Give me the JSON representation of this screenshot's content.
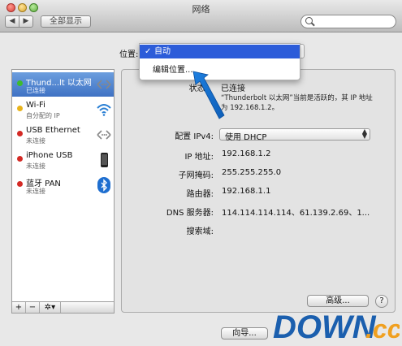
{
  "window": {
    "title": "网络"
  },
  "toolbar": {
    "back_label": "◀",
    "forward_label": "▶",
    "show_all_label": "全部显示",
    "search_placeholder": ""
  },
  "location": {
    "label": "位置:",
    "options": [
      {
        "label": "自动",
        "checked": true
      },
      {
        "label": "编辑位置..."
      }
    ],
    "check": "✓"
  },
  "services": [
    {
      "name": "Thund...lt 以太网",
      "status": "已连接",
      "dot": "green",
      "icon": "ethernet-icon"
    },
    {
      "name": "Wi-Fi",
      "status": "自分配的 IP",
      "dot": "yellow",
      "icon": "wifi-icon"
    },
    {
      "name": "USB Ethernet",
      "status": "未连接",
      "dot": "red",
      "icon": "ethernet-icon"
    },
    {
      "name": "iPhone USB",
      "status": "未连接",
      "dot": "red",
      "icon": "iphone-icon"
    },
    {
      "name": "蓝牙 PAN",
      "status": "未连接",
      "dot": "red",
      "icon": "bluetooth-icon"
    }
  ],
  "sidebar_buttons": {
    "add": "+",
    "remove": "−",
    "gear": "✲▾"
  },
  "detail": {
    "status_label": "状态:",
    "status_value": "已连接",
    "status_desc_1": "“Thunderbolt 以太网”当前是活跃的，其 IP 地址",
    "status_desc_2": "为 192.168.1.2。",
    "configure_label": "配置 IPv4:",
    "configure_value": "使用 DHCP",
    "ip_label": "IP 地址:",
    "ip_value": "192.168.1.2",
    "subnet_label": "子网掩码:",
    "subnet_value": "255.255.255.0",
    "router_label": "路由器:",
    "router_value": "192.168.1.1",
    "dns_label": "DNS 服务器:",
    "dns_value": "114.114.114.114、61.139.2.69、1...",
    "search_domain_label": "搜索域:",
    "advanced_label": "高级...",
    "help_label": "?"
  },
  "footer": {
    "assist_label": "向导..."
  },
  "watermark": {
    "text_main": "DOWN",
    "text_suffix": ".cc",
    "colors": {
      "blue": "#1b5fae",
      "orange": "#f0a020"
    }
  }
}
